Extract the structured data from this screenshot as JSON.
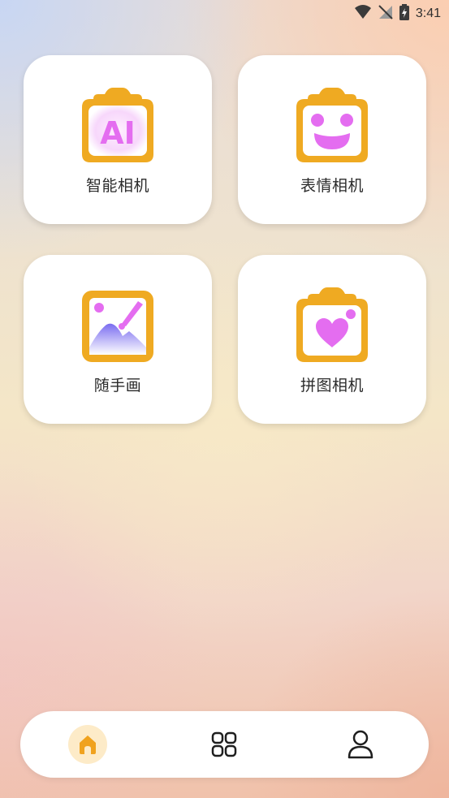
{
  "status": {
    "time": "3:41",
    "icons": [
      "wifi-icon",
      "signal-off-icon",
      "battery-charging-icon"
    ]
  },
  "cards": [
    {
      "name": "ai-camera",
      "label": "智能相机",
      "icon": "ai-camera-icon",
      "icon_text": "AI"
    },
    {
      "name": "emoji-camera",
      "label": "表情相机",
      "icon": "smile-camera-icon"
    },
    {
      "name": "freehand-draw",
      "label": "随手画",
      "icon": "brush-picture-icon"
    },
    {
      "name": "collage-camera",
      "label": "拼图相机",
      "icon": "heart-camera-icon"
    }
  ],
  "nav": {
    "items": [
      "home-icon",
      "grid-icon",
      "profile-icon"
    ],
    "active": "home-icon"
  },
  "colors": {
    "camera_frame": "#efaa22",
    "accent_purple": "#e46df0",
    "nav_active_bg": "#fdebc8"
  }
}
